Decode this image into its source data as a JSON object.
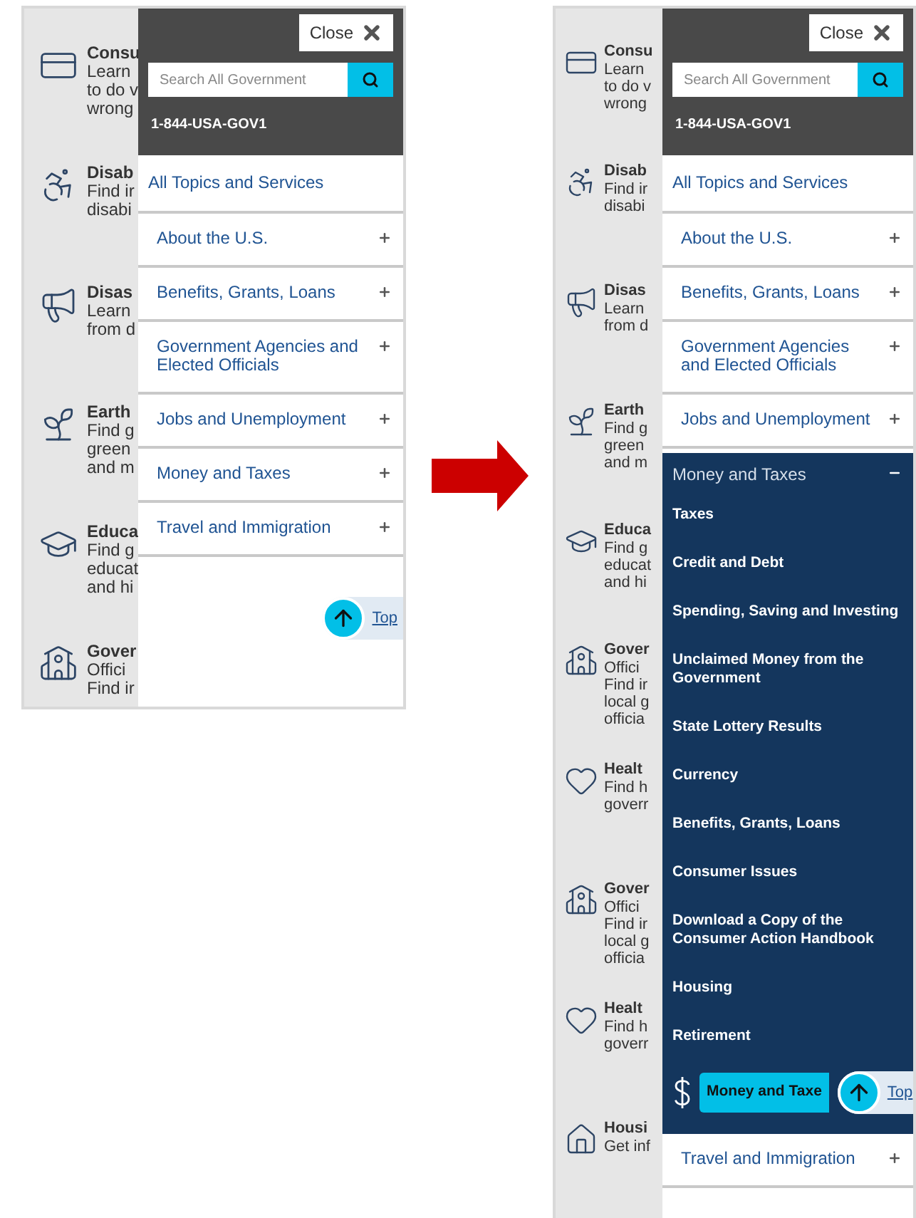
{
  "screens": [
    {
      "background_items": [
        {
          "kind": "card",
          "title": "Consu",
          "lines": [
            "Learn",
            "to do v",
            "wrong"
          ]
        },
        {
          "kind": "wheelchair",
          "title": "Disab",
          "lines": [
            "Find ir",
            "disabi"
          ]
        },
        {
          "kind": "megaphone",
          "title": "Disas",
          "lines": [
            "Learn",
            "from d"
          ]
        },
        {
          "kind": "sprout",
          "title": "Earth",
          "lines": [
            "Find g",
            "green",
            "and m"
          ]
        },
        {
          "kind": "graduation",
          "title": "Educa",
          "lines": [
            "Find g",
            "educat",
            "and hi"
          ]
        },
        {
          "kind": "building",
          "title": "Gover",
          "lines": [
            "Offici",
            "Find ir"
          ]
        }
      ],
      "menu": {
        "close": "Close",
        "search_placeholder": "Search All Government",
        "phone": "1-844-USA-GOV1",
        "all_topics": "All Topics and Services",
        "sections": [
          {
            "label": "About the U.S.",
            "expanded": false
          },
          {
            "label": "Benefits, Grants, Loans",
            "expanded": false
          },
          {
            "label": "Government Agencies and Elected Officials",
            "expanded": false
          },
          {
            "label": "Jobs and Unemployment",
            "expanded": false
          },
          {
            "label": "Money and Taxes",
            "expanded": false
          },
          {
            "label": "Travel and Immigration",
            "expanded": false
          }
        ]
      },
      "back_to_top": "Top"
    },
    {
      "background_items": [
        {
          "kind": "card",
          "title": "Consu",
          "lines": [
            "Learn",
            "to do v",
            "wrong"
          ]
        },
        {
          "kind": "wheelchair",
          "title": "Disab",
          "lines": [
            "Find ir",
            "disabi"
          ]
        },
        {
          "kind": "megaphone",
          "title": "Disas",
          "lines": [
            "Learn",
            "from d"
          ]
        },
        {
          "kind": "sprout",
          "title": "Earth",
          "lines": [
            "Find g",
            "green",
            "and m"
          ]
        },
        {
          "kind": "graduation",
          "title": "Educa",
          "lines": [
            "Find g",
            "educat",
            "and hi"
          ]
        },
        {
          "kind": "building",
          "title": "Gover",
          "lines": [
            "Offici",
            "Find ir",
            "local g",
            "officia"
          ]
        },
        {
          "kind": "heart",
          "title": "Healt",
          "lines": [
            "Find h",
            "goverr"
          ]
        },
        {
          "kind": "building",
          "title": "Gover",
          "lines": [
            "Offici",
            "Find ir",
            "local g",
            "officia"
          ]
        },
        {
          "kind": "heart",
          "title": "Healt",
          "lines": [
            "Find h",
            "goverr"
          ]
        },
        {
          "kind": "house",
          "title": "Housi",
          "lines": [
            "Get inf"
          ]
        }
      ],
      "menu": {
        "close": "Close",
        "search_placeholder": "Search All Government",
        "phone": "1-844-USA-GOV1",
        "all_topics": "All Topics and Services",
        "sections": [
          {
            "label": "About the U.S.",
            "expanded": false
          },
          {
            "label": "Benefits, Grants, Loans",
            "expanded": false
          },
          {
            "label": "Government Agencies and Elected Officials",
            "expanded": false
          },
          {
            "label": "Jobs and Unemployment",
            "expanded": false
          },
          {
            "label": "Money and Taxes",
            "expanded": true,
            "children": [
              "Taxes",
              "Credit and Debt",
              "Spending, Saving and Investing",
              "Unclaimed Money from the Government",
              "State Lottery Results",
              "Currency",
              "Benefits, Grants, Loans",
              "Consumer Issues",
              "Download a Copy of the Consumer Action Handbook",
              "Housing",
              "Retirement"
            ],
            "footer_label": "Money and Taxe"
          },
          {
            "label": "Travel and Immigration",
            "expanded": false
          }
        ]
      },
      "back_to_top": "Top"
    }
  ]
}
